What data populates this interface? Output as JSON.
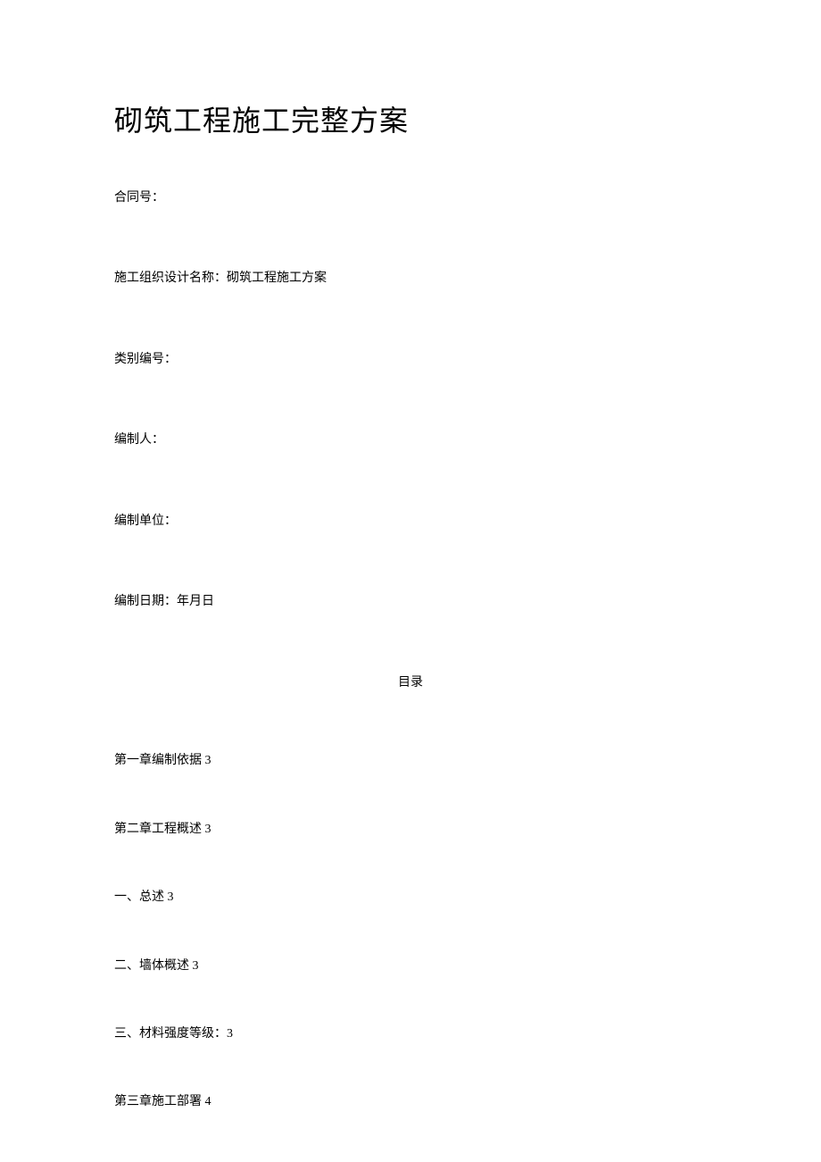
{
  "title": "砌筑工程施工完整方案",
  "fields": {
    "contract_number": "合同号：",
    "design_name": "施工组织设计名称：砌筑工程施工方案",
    "category_number": "类别编号：",
    "author": "编制人：",
    "unit": "编制单位：",
    "date": "编制日期：年月日"
  },
  "toc_heading": "目录",
  "toc": [
    "第一章编制依据 3",
    "第二章工程概述 3",
    "一、总述 3",
    "二、墙体概述 3",
    "三、材料强度等级：3",
    "第三章施工部署 4"
  ]
}
